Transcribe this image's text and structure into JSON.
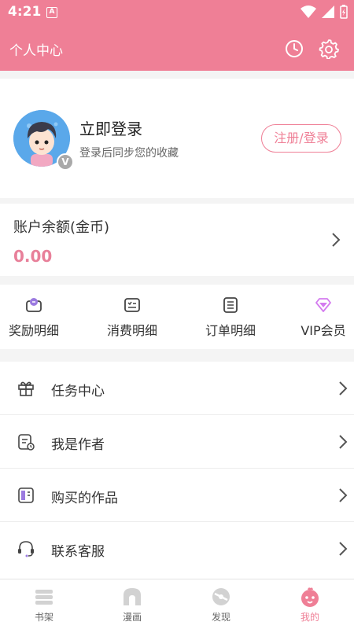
{
  "status_bar": {
    "time": "4:21",
    "notification": "A"
  },
  "header": {
    "title": "个人中心"
  },
  "profile": {
    "title": "立即登录",
    "subtitle": "登录后同步您的收藏",
    "badge": "V",
    "login_button": "注册/登录"
  },
  "balance": {
    "label": "账户余额(金币)",
    "amount": "0.00"
  },
  "quick_links": [
    {
      "label": "奖励明细",
      "icon": "reward-icon"
    },
    {
      "label": "消费明细",
      "icon": "consume-icon"
    },
    {
      "label": "订单明细",
      "icon": "order-icon"
    },
    {
      "label": "VIP会员",
      "icon": "vip-diamond-icon"
    }
  ],
  "menu": [
    {
      "label": "任务中心",
      "icon": "gift-icon"
    },
    {
      "label": "我是作者",
      "icon": "author-icon"
    },
    {
      "label": "购买的作品",
      "icon": "book-icon"
    },
    {
      "label": "联系客服",
      "icon": "headset-icon"
    }
  ],
  "tabs": [
    {
      "label": "书架",
      "icon": "bookshelf-icon",
      "active": false
    },
    {
      "label": "漫画",
      "icon": "comic-icon",
      "active": false
    },
    {
      "label": "发现",
      "icon": "discover-icon",
      "active": false
    },
    {
      "label": "我的",
      "icon": "mine-icon",
      "active": true
    }
  ],
  "colors": {
    "brand": "#ef7f96",
    "balance": "#e8809a",
    "vip": "#d47bef"
  }
}
